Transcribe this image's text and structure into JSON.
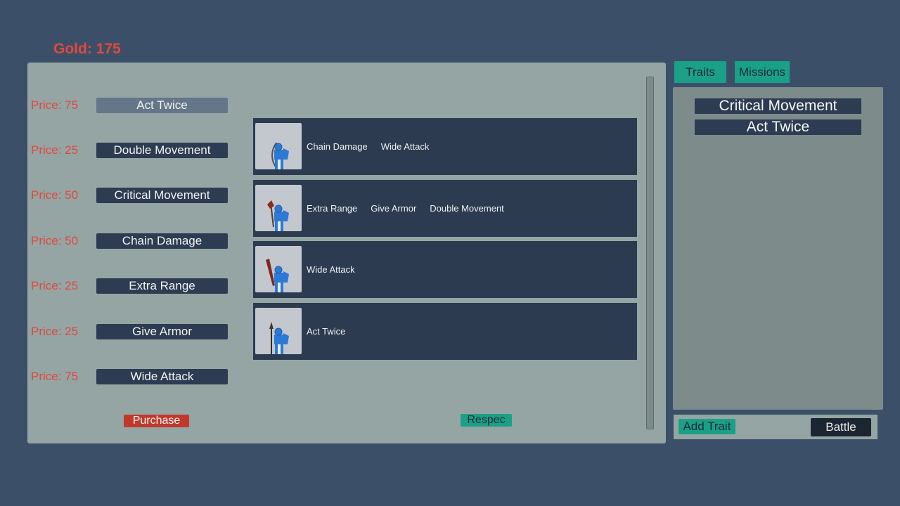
{
  "gold_label": "Gold: 175",
  "shop": {
    "traits": [
      {
        "price": "Price: 75",
        "name": "Act Twice"
      },
      {
        "price": "Price: 25",
        "name": "Double Movement"
      },
      {
        "price": "Price: 50",
        "name": "Critical Movement"
      },
      {
        "price": "Price: 50",
        "name": "Chain Damage"
      },
      {
        "price": "Price: 25",
        "name": "Extra Range"
      },
      {
        "price": "Price: 25",
        "name": "Give Armor"
      },
      {
        "price": "Price: 75",
        "name": "Wide Attack"
      }
    ],
    "purchase_label": "Purchase",
    "respec_label": "Respec"
  },
  "units": [
    {
      "weapon": "bow-icon",
      "traits": [
        "Chain Damage",
        "Wide Attack"
      ]
    },
    {
      "weapon": "axe-icon",
      "traits": [
        "Extra Range",
        "Give Armor",
        "Double Movement"
      ]
    },
    {
      "weapon": "club-icon",
      "traits": [
        "Wide Attack"
      ]
    },
    {
      "weapon": "spear-icon",
      "traits": [
        "Act Twice"
      ]
    }
  ],
  "tabs": {
    "traits": "Traits",
    "missions": "Missions"
  },
  "owned_traits": [
    "Critical Movement",
    "Act Twice"
  ],
  "actions": {
    "add_trait": "Add Trait",
    "battle": "Battle"
  },
  "colors": {
    "background": "#3b5068",
    "panel": "#94a5a4",
    "dark_item": "#2d3c52",
    "accent_red": "#e0493c",
    "accent_teal": "#1ba088"
  }
}
